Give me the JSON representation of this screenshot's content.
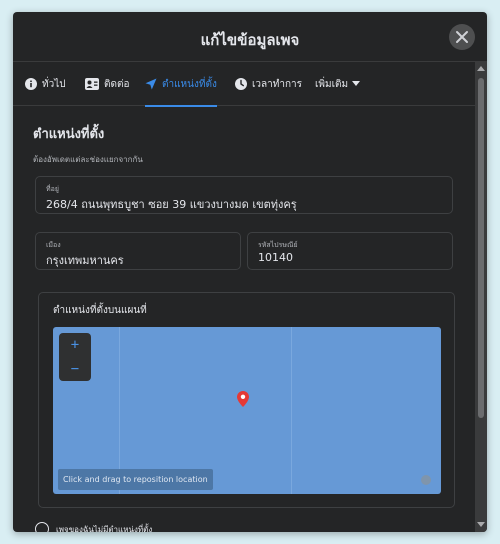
{
  "dialog": {
    "title": "แก้ไขข้อมูลเพจ"
  },
  "tabs": [
    {
      "label": "ทั่วไป",
      "icon": "info-icon"
    },
    {
      "label": "ติดต่อ",
      "icon": "contact-card-icon"
    },
    {
      "label": "ตำแหน่งที่ตั้ง",
      "icon": "location-arrow-icon",
      "active": true
    },
    {
      "label": "เวลาทำการ",
      "icon": "clock-icon"
    },
    {
      "label": "เพิ่มเติม",
      "icon": "caret-down-icon"
    }
  ],
  "section": {
    "title": "ตำแหน่งที่ตั้ง",
    "subtitle": "ต้องอัพเดตแต่ละช่องแยกจากกัน"
  },
  "fields": {
    "address": {
      "label": "ที่อยู่",
      "value": "268/4 ถนนพุทธบูชา ซอย 39 แขวงบางมด เขตทุ่งครุ"
    },
    "city": {
      "label": "เมือง",
      "value": "กรุงเทพมหานคร"
    },
    "zip": {
      "label": "รหัสไปรษณีย์",
      "value": "10140"
    }
  },
  "map": {
    "title": "ตำแหน่งที่ตั้งบนแผนที่",
    "zoom_in": "+",
    "zoom_out": "−",
    "hint": "Click and drag to reposition location"
  },
  "no_location": {
    "label": "เพจของฉันไม่มีตำแหน่งที่ตั้ง"
  },
  "colors": {
    "accent": "#3a8be8",
    "map_water": "#6699d6",
    "pin": "#e53935",
    "dialog_bg": "#242526"
  }
}
